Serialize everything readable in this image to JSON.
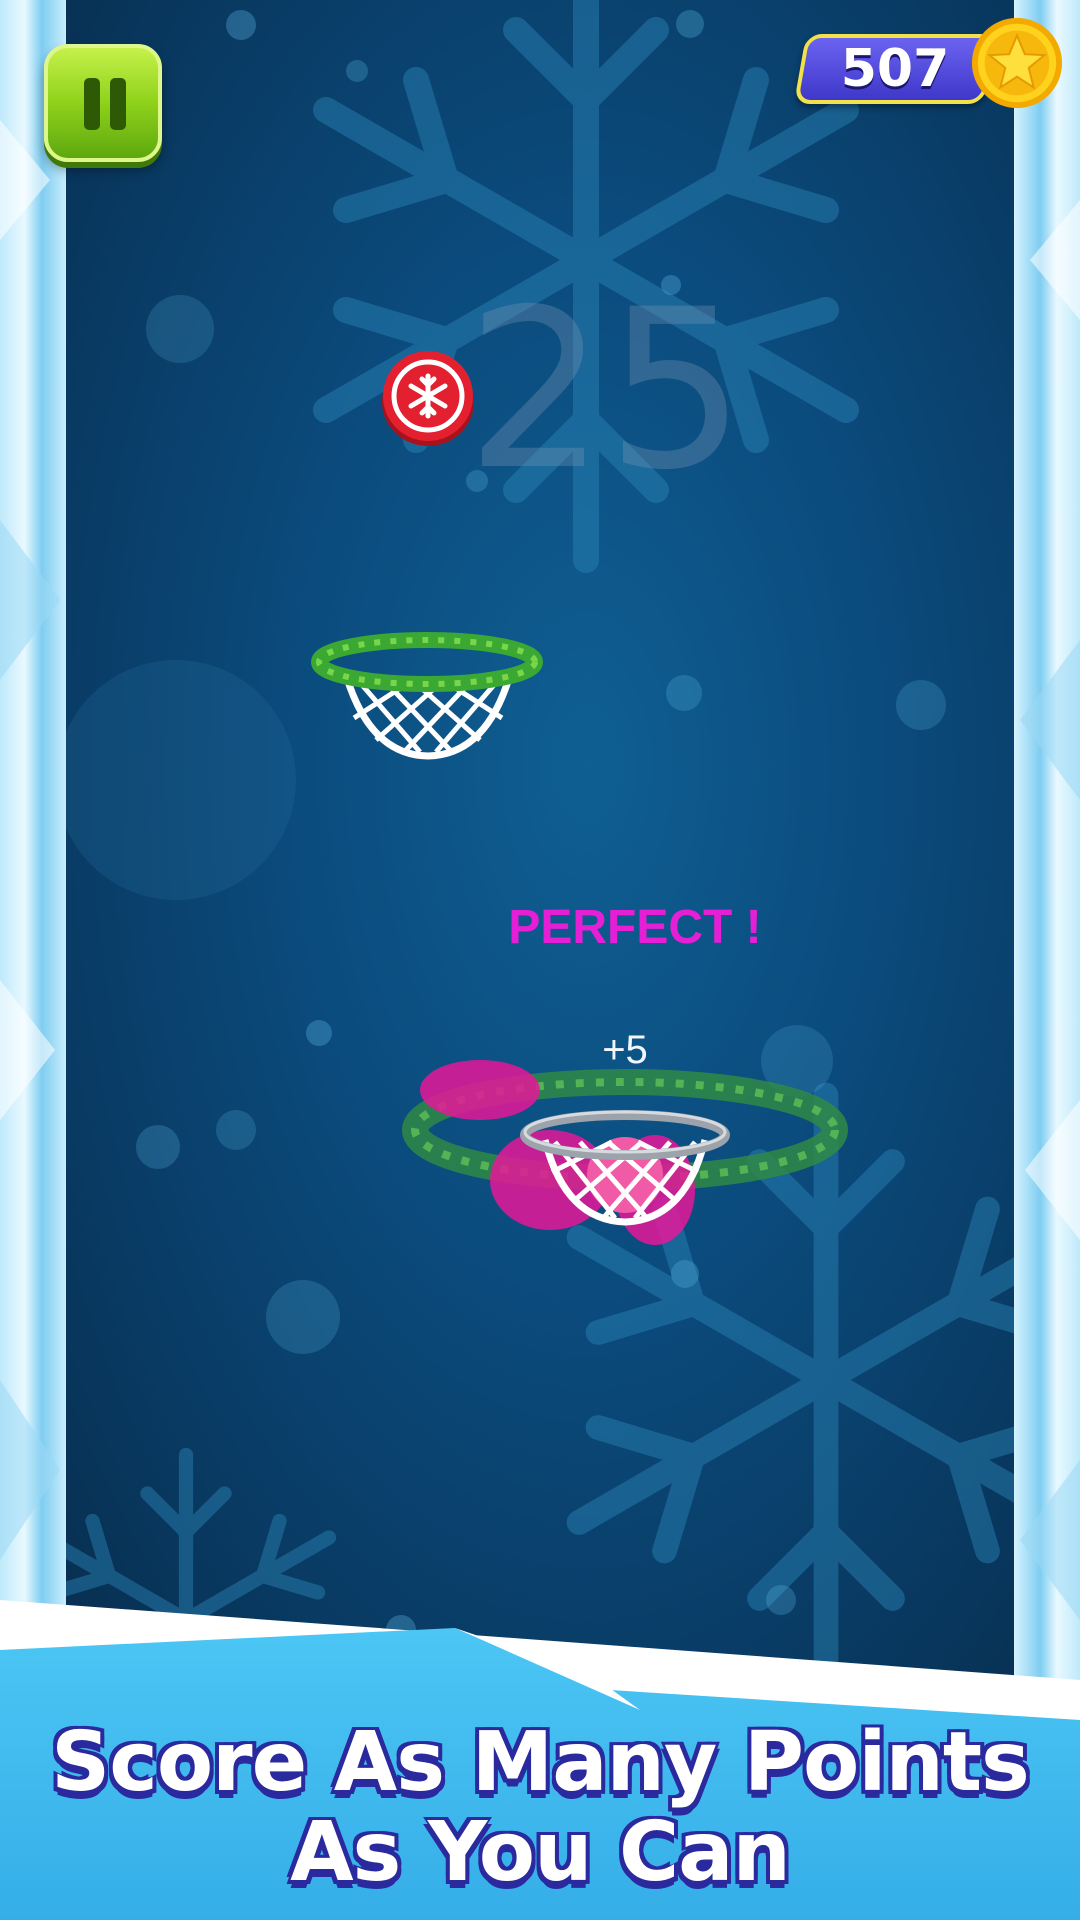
{
  "hud": {
    "coins": "507",
    "coin_icon": "star-coin-icon",
    "pause_icon": "pause-icon",
    "score": "25"
  },
  "feedback": {
    "perfect": "PERFECT !",
    "points": "+5"
  },
  "powerup": {
    "icon": "snowflake-icon",
    "color": "#e3202f"
  },
  "banner": {
    "line1": "Score As Many Points",
    "line2": "As You Can"
  },
  "colors": {
    "field": "#0b4b7d",
    "pause": "#8fd21b",
    "coin_plate": "#3f37c9",
    "perfect": "#e41fd6",
    "banner": "#39b8ef",
    "slogan_outline": "#2a2a9e"
  }
}
